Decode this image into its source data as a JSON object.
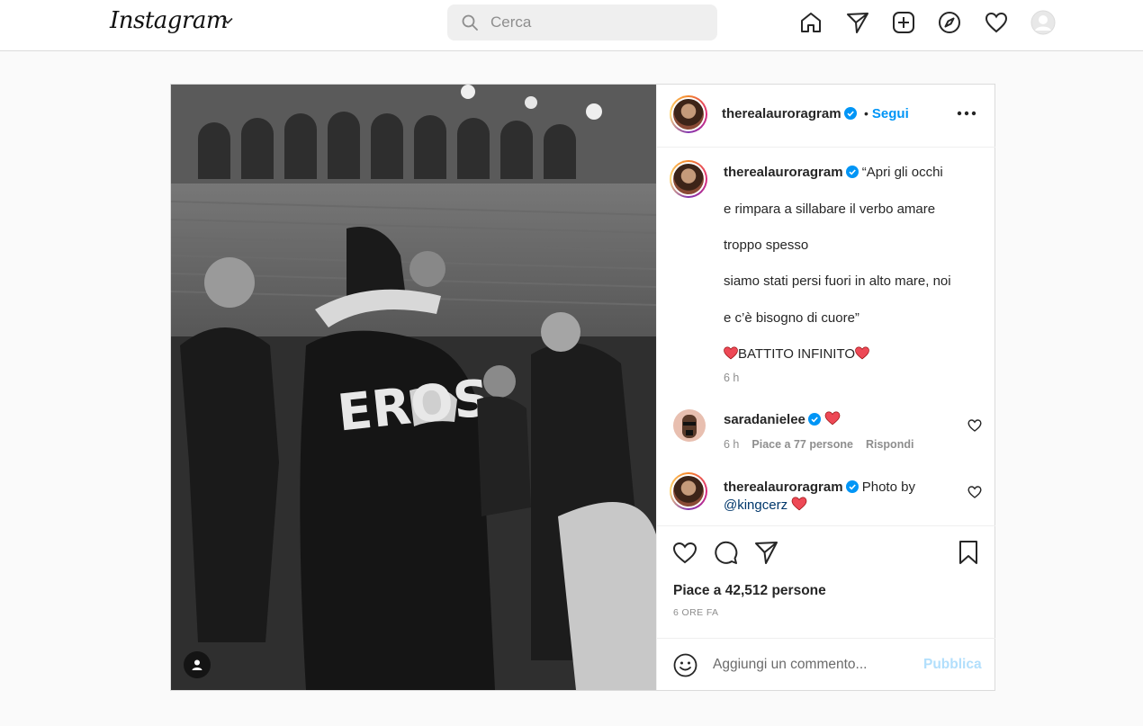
{
  "topnav": {
    "logo": "Instagram",
    "search_placeholder": "Cerca",
    "icons": [
      "home-icon",
      "direct-icon",
      "new-post-icon",
      "explore-icon",
      "activity-heart-icon",
      "profile-avatar"
    ]
  },
  "post": {
    "author": "therealauroragram",
    "follow_label": "Segui",
    "separator": "•",
    "caption_lines": [
      "“Apri gli occhi",
      "e rimpara a sillabare il verbo amare",
      "troppo spesso",
      "siamo stati persi fuori in alto mare, noi",
      "e c’è bisogno di cuore”",
      "BATTITO INFINITO"
    ],
    "caption_time": "6 h",
    "comments": [
      {
        "user": "saradanielee",
        "time": "6 h",
        "likes": "Piace a 77 persone",
        "reply": "Rispondi"
      },
      {
        "user": "therealauroragram",
        "text": "Photo by",
        "mention": "@kingcerz"
      }
    ],
    "likes_text": "Piace a 42,512 persone",
    "time_ago": "6 ORE FA",
    "add_comment_placeholder": "Aggiungi un commento...",
    "publish_label": "Pubblica",
    "photo_text": "EROS"
  },
  "colors": {
    "accent": "#0095f6",
    "publish_disabled": "#b2dffc",
    "heart_red": "#ed4956",
    "border": "#dbdbdb",
    "muted": "#8e8e8e"
  }
}
